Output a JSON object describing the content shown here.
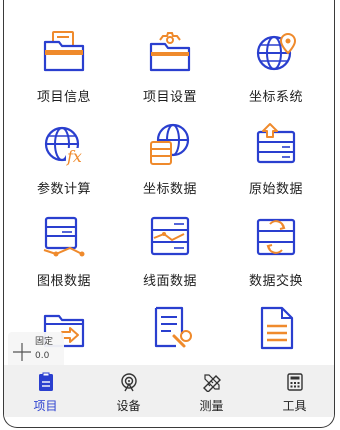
{
  "colors": {
    "accent": "#2a3fcf",
    "icon_secondary": "#ef8a2c",
    "icon_outline": "#1e2f8a"
  },
  "tiles": [
    {
      "label": "项目信息",
      "icon": "folder-document-icon"
    },
    {
      "label": "项目设置",
      "icon": "folder-gear-icon"
    },
    {
      "label": "坐标系统",
      "icon": "globe-pin-icon"
    },
    {
      "label": "参数计算",
      "icon": "globe-function-icon"
    },
    {
      "label": "坐标数据",
      "icon": "globe-database-icon"
    },
    {
      "label": "原始数据",
      "icon": "raw-data-icon"
    },
    {
      "label": "图根数据",
      "icon": "control-point-data-icon"
    },
    {
      "label": "线面数据",
      "icon": "line-area-data-icon"
    },
    {
      "label": "数据交换",
      "icon": "data-exchange-icon"
    },
    {
      "label": "",
      "icon": "folder-export-icon"
    },
    {
      "label": "",
      "icon": "document-tools-icon"
    },
    {
      "label": "",
      "icon": "document-icon"
    }
  ],
  "fixed_badge": {
    "title": "固定",
    "value": "0.0"
  },
  "tabbar": {
    "active": "项目",
    "tabs": [
      {
        "label": "项目",
        "icon": "clipboard-icon"
      },
      {
        "label": "设备",
        "icon": "antenna-icon"
      },
      {
        "label": "测量",
        "icon": "ruler-pencil-icon"
      },
      {
        "label": "工具",
        "icon": "calculator-icon"
      }
    ]
  }
}
